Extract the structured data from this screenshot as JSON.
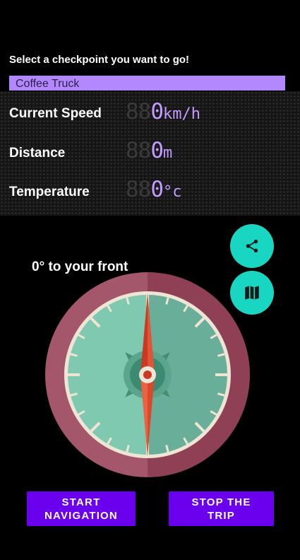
{
  "prompt": "Select a checkpoint you want to go!",
  "checkpoint": {
    "selected": "Coffee Truck"
  },
  "stats": [
    {
      "label": "Current Speed",
      "ghost": "88",
      "value": "0",
      "unit": "km/h"
    },
    {
      "label": "Distance",
      "ghost": "88",
      "value": "0",
      "unit": "m"
    },
    {
      "label": "Temperature",
      "ghost": "88",
      "value": "0",
      "unit": "°c"
    }
  ],
  "heading_text": "0° to your front",
  "fabs": {
    "share_icon": "share-icon",
    "map_icon": "map-icon"
  },
  "buttons": {
    "start": "START NAVIGATION",
    "stop": "STOP THE TRIP"
  },
  "colors": {
    "accent": "#b388ff",
    "digits": "#c39bff",
    "fab": "#19d6c2",
    "button": "#6a00ee",
    "compass_ring": "#9a4a5e",
    "compass_face": "#6bb79c",
    "needle": "#d9472b"
  }
}
